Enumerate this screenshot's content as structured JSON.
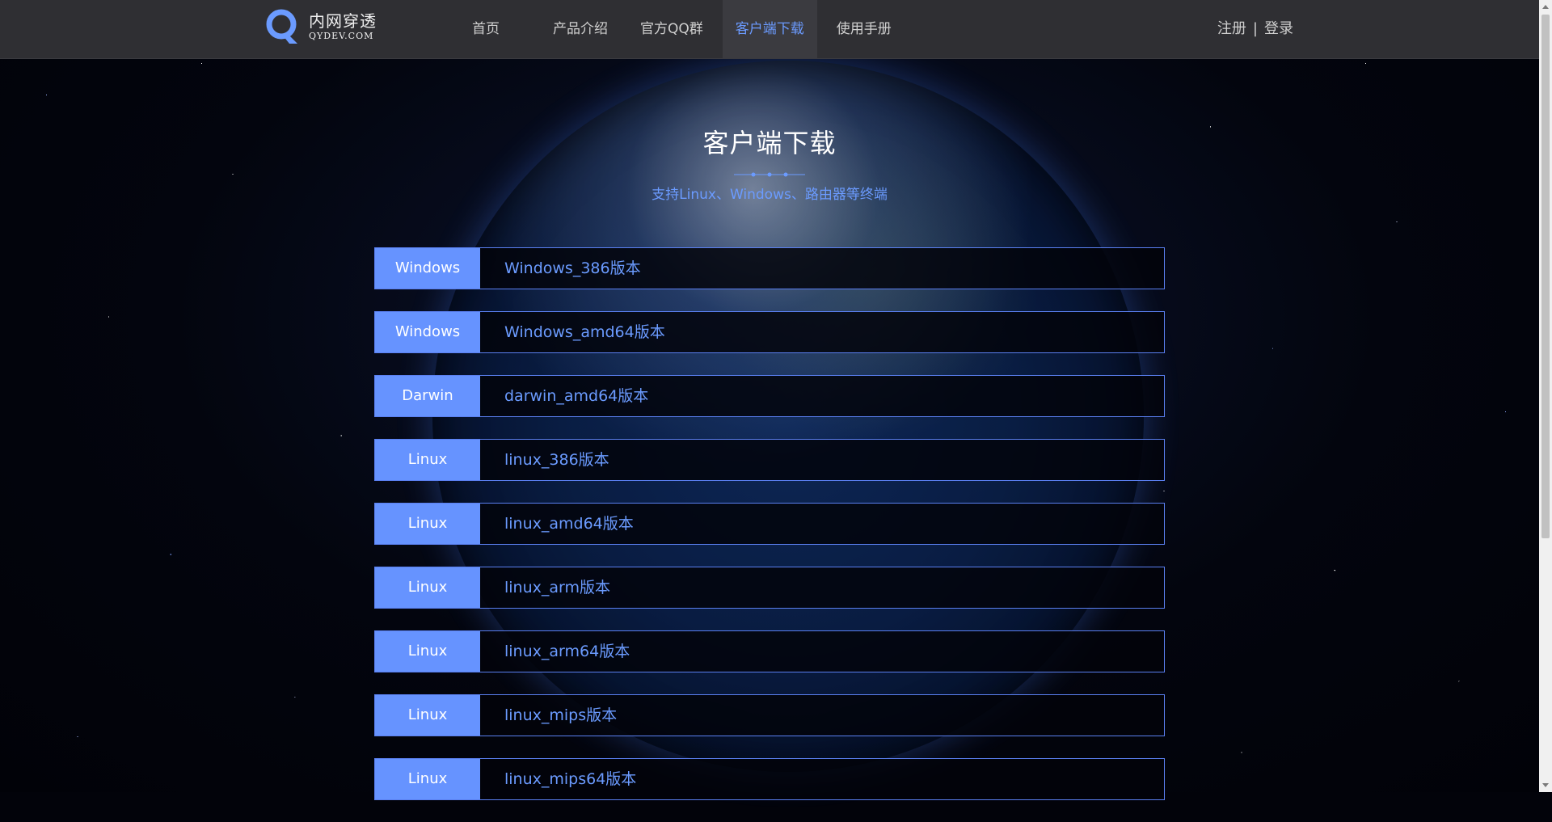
{
  "header": {
    "logo": {
      "name": "内网穿透",
      "sub": "QYDEV.COM",
      "icon": "q-logo-icon",
      "accent": "#6b9bff"
    },
    "nav": [
      {
        "label": "首页"
      },
      {
        "label": "产品介绍"
      },
      {
        "label": "官方QQ群"
      },
      {
        "label": "客户端下载"
      },
      {
        "label": "使用手册"
      }
    ],
    "active_nav": "客户端下载",
    "auth": {
      "register": "注册",
      "separator": "|",
      "login": "登录"
    }
  },
  "main": {
    "title": "客户端下载",
    "subtitle": "支持Linux、Windows、路由器等终端",
    "downloads": [
      {
        "platform": "Windows",
        "file": "Windows_386版本"
      },
      {
        "platform": "Windows",
        "file": "Windows_amd64版本"
      },
      {
        "platform": "Darwin",
        "file": "darwin_amd64版本"
      },
      {
        "platform": "Linux",
        "file": "linux_386版本"
      },
      {
        "platform": "Linux",
        "file": "linux_amd64版本"
      },
      {
        "platform": "Linux",
        "file": "linux_arm版本"
      },
      {
        "platform": "Linux",
        "file": "linux_arm64版本"
      },
      {
        "platform": "Linux",
        "file": "linux_mips版本"
      },
      {
        "platform": "Linux",
        "file": "linux_mips64版本"
      }
    ]
  },
  "colors": {
    "tag_bg": "#6693ff",
    "link": "#6b9bff",
    "header_bg": "#2f2f33"
  }
}
